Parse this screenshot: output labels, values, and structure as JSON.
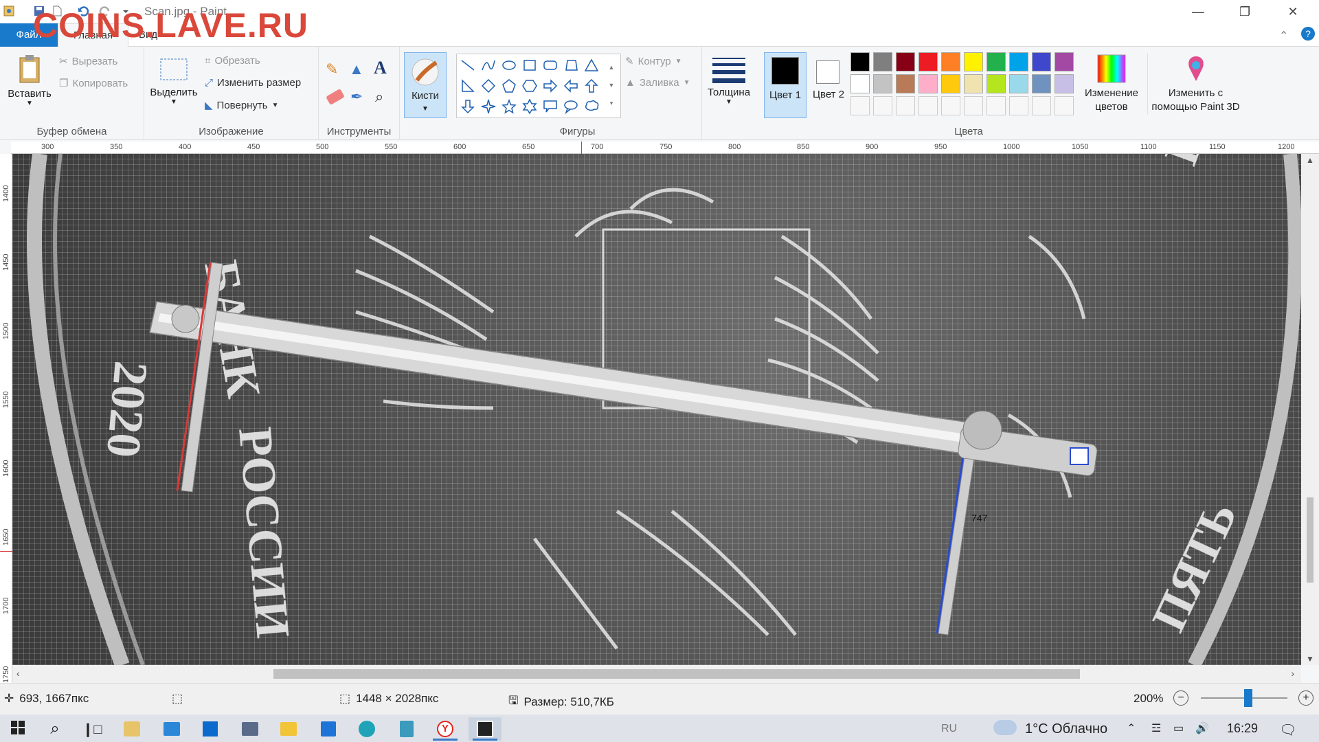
{
  "window": {
    "title": "Scan.jpg - Paint",
    "watermark": "COINS.LAVE.RU",
    "minimize_icon": "minimize-icon",
    "restore_icon": "restore-icon",
    "close_icon": "close-icon"
  },
  "tabs": [
    {
      "label": "Файл"
    },
    {
      "label": "Главная"
    },
    {
      "label": "Вид"
    }
  ],
  "ribbon": {
    "clipboard": {
      "paste": "Вставить",
      "cut": "Вырезать",
      "copy": "Копировать",
      "label": "Буфер обмена"
    },
    "image": {
      "select": "Выделить",
      "crop": "Обрезать",
      "resize": "Изменить размер",
      "rotate": "Повернуть",
      "label": "Изображение"
    },
    "tools": {
      "label": "Инструменты"
    },
    "brushes": {
      "label": "Кисти"
    },
    "shapes": {
      "outline": "Контур",
      "fill": "Заливка",
      "label": "Фигуры"
    },
    "size": {
      "label": "Толщина"
    },
    "colors": {
      "color1": "Цвет 1",
      "color2": "Цвет 2",
      "edit": "Изменение цветов",
      "paint3d": "Изменить с помощью Paint 3D",
      "label": "Цвета",
      "primary": "#000000",
      "secondary": "#ffffff",
      "row1": [
        "#000000",
        "#7f7f7f",
        "#880015",
        "#ed1c24",
        "#ff7f27",
        "#fff200",
        "#22b14c",
        "#00a2e8",
        "#3f48cc",
        "#a349a4"
      ],
      "row2": [
        "#ffffff",
        "#c3c3c3",
        "#b97a57",
        "#ffaec9",
        "#ffc90e",
        "#efe4b0",
        "#b5e61d",
        "#99d9ea",
        "#7092be",
        "#c8bfe7"
      ]
    }
  },
  "rulers": {
    "h": [
      "300",
      "350",
      "400",
      "450",
      "500",
      "550",
      "600",
      "650",
      "700",
      "750",
      "800",
      "850",
      "900",
      "950",
      "1000",
      "1050",
      "1100",
      "1150",
      "1200"
    ],
    "v": [
      "1400",
      "1450",
      "1500",
      "1550",
      "1600",
      "1650",
      "1700",
      "1750"
    ]
  },
  "canvas": {
    "caliper_reading": "747"
  },
  "status": {
    "cursor_pos": "693, 1667пкс",
    "image_size": "1448 × 2028пкс",
    "file_size": "Размер: 510,7КБ",
    "zoom": "200%",
    "zoom_level": 0.55
  },
  "taskbar": {
    "lang": "RU",
    "weather": "1°C  Облачно",
    "time": "16:29"
  }
}
